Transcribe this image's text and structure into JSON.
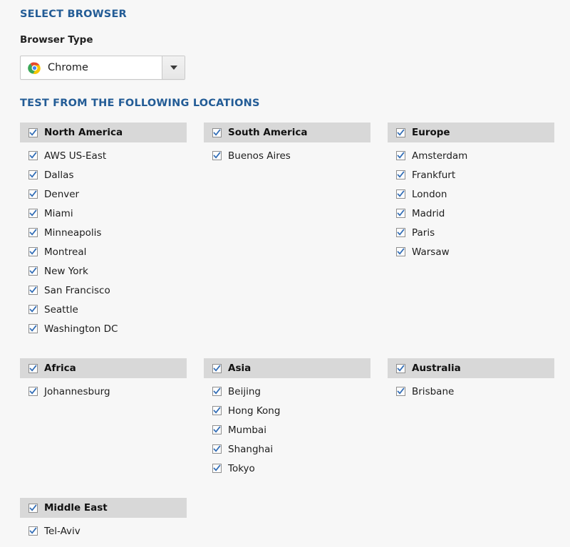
{
  "sections": {
    "browser_heading": "SELECT BROWSER",
    "locations_heading": "TEST FROM THE FOLLOWING LOCATIONS"
  },
  "browser": {
    "field_label": "Browser Type",
    "selected_value": "Chrome",
    "icon": "chrome-icon",
    "dropdown_icon": "caret-down-icon"
  },
  "colors": {
    "heading_blue": "#235c96",
    "group_header_bg": "#d8d8d8",
    "page_bg": "#f7f7f7",
    "checkbox_check": "#2f6bb5"
  },
  "location_groups": [
    {
      "name": "North America",
      "checked": true,
      "items": [
        {
          "label": "AWS US-East",
          "checked": true
        },
        {
          "label": "Dallas",
          "checked": true
        },
        {
          "label": "Denver",
          "checked": true
        },
        {
          "label": "Miami",
          "checked": true
        },
        {
          "label": "Minneapolis",
          "checked": true
        },
        {
          "label": "Montreal",
          "checked": true
        },
        {
          "label": "New York",
          "checked": true
        },
        {
          "label": "San Francisco",
          "checked": true
        },
        {
          "label": "Seattle",
          "checked": true
        },
        {
          "label": "Washington DC",
          "checked": true
        }
      ]
    },
    {
      "name": "South America",
      "checked": true,
      "items": [
        {
          "label": "Buenos Aires",
          "checked": true
        }
      ]
    },
    {
      "name": "Europe",
      "checked": true,
      "items": [
        {
          "label": "Amsterdam",
          "checked": true
        },
        {
          "label": "Frankfurt",
          "checked": true
        },
        {
          "label": "London",
          "checked": true
        },
        {
          "label": "Madrid",
          "checked": true
        },
        {
          "label": "Paris",
          "checked": true
        },
        {
          "label": "Warsaw",
          "checked": true
        }
      ]
    },
    {
      "name": "Africa",
      "checked": true,
      "items": [
        {
          "label": "Johannesburg",
          "checked": true
        }
      ]
    },
    {
      "name": "Asia",
      "checked": true,
      "items": [
        {
          "label": "Beijing",
          "checked": true
        },
        {
          "label": "Hong Kong",
          "checked": true
        },
        {
          "label": "Mumbai",
          "checked": true
        },
        {
          "label": "Shanghai",
          "checked": true
        },
        {
          "label": "Tokyo",
          "checked": true
        }
      ]
    },
    {
      "name": "Australia",
      "checked": true,
      "items": [
        {
          "label": "Brisbane",
          "checked": true
        }
      ]
    },
    {
      "name": "Middle East",
      "checked": true,
      "items": [
        {
          "label": "Tel-Aviv",
          "checked": true
        }
      ]
    }
  ]
}
